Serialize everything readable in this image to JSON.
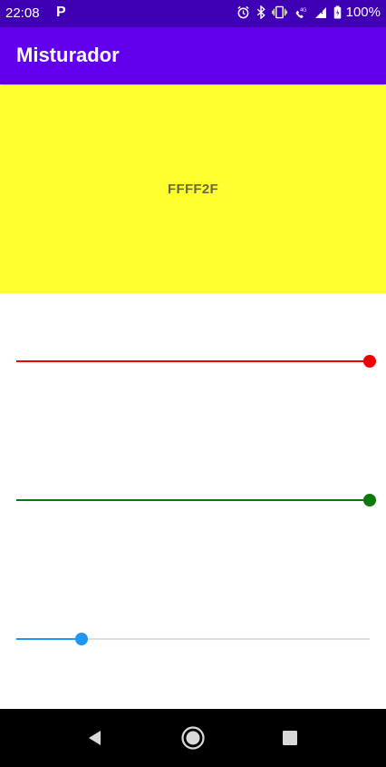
{
  "status_bar": {
    "time": "22:08",
    "notification_icon": "P",
    "battery_percent": "100%",
    "icons": [
      "alarm-icon",
      "bluetooth-icon",
      "vibrate-icon",
      "volte-icon",
      "signal-icon",
      "battery-icon"
    ]
  },
  "app_bar": {
    "title": "Misturador",
    "color": "#6200ee"
  },
  "preview": {
    "hex_value": "FFFF2F",
    "background_color": "#ffff2f"
  },
  "sliders": [
    {
      "name": "red",
      "color": "#f00000",
      "value_fraction": 1.0
    },
    {
      "name": "green",
      "color": "#0a7a0a",
      "value_fraction": 1.0
    },
    {
      "name": "blue",
      "color": "#2196f3",
      "value_fraction": 0.184
    }
  ],
  "nav_bar": {
    "buttons": [
      "back-icon",
      "home-icon",
      "recents-icon"
    ]
  }
}
